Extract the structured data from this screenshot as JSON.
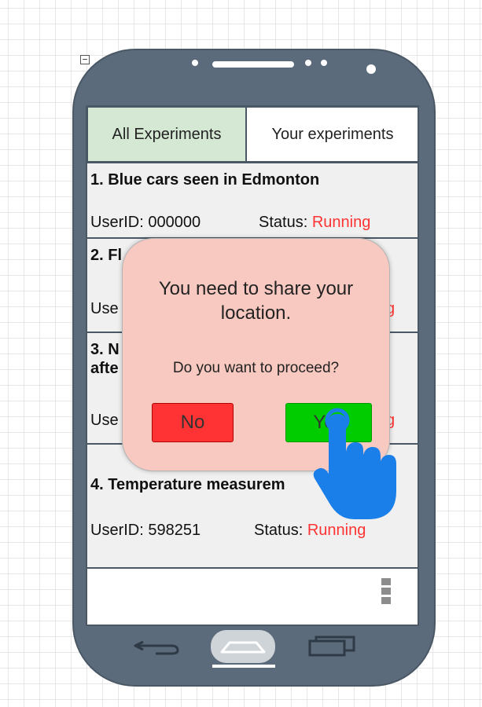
{
  "tabs": {
    "all_label": "All Experiments",
    "yours_label": "Your experiments"
  },
  "experiments": [
    {
      "title": "1. Blue cars seen in Edmonton",
      "user": "UserID: 000000",
      "status_label": "Status:",
      "status_value": "Running"
    },
    {
      "title_visible": "2. Fl",
      "user_visible": "Use",
      "status_value_visible": "g"
    },
    {
      "title_line1_visible": "3. N",
      "title_line2_visible": "afte",
      "user_visible": "Use",
      "status_value_visible": "g"
    },
    {
      "title": "4. Temperature measurem",
      "user": "UserID: 598251",
      "status_label": "Status:",
      "status_value": "Running"
    }
  ],
  "dialog": {
    "title": "You need to share your location.",
    "question": "Do you want to proceed?",
    "no_label": "No",
    "yes_label": "Yes"
  },
  "colors": {
    "phone_body": "#5c6b7b",
    "tab_active": "#d5e8d4",
    "card_bg": "#f0f0f0",
    "status_running": "#ff3333",
    "dialog_bg": "#f8c9c1",
    "button_no": "#ff3333",
    "button_yes": "#00cc00",
    "hand_cursor": "#1a7fe8"
  },
  "icons": {
    "collapse": "minus-box-icon",
    "cursor": "pointing-hand-icon",
    "menu": "overflow-menu-icon",
    "back": "back-arrow-icon",
    "home": "home-icon",
    "recent": "recent-apps-icon"
  }
}
